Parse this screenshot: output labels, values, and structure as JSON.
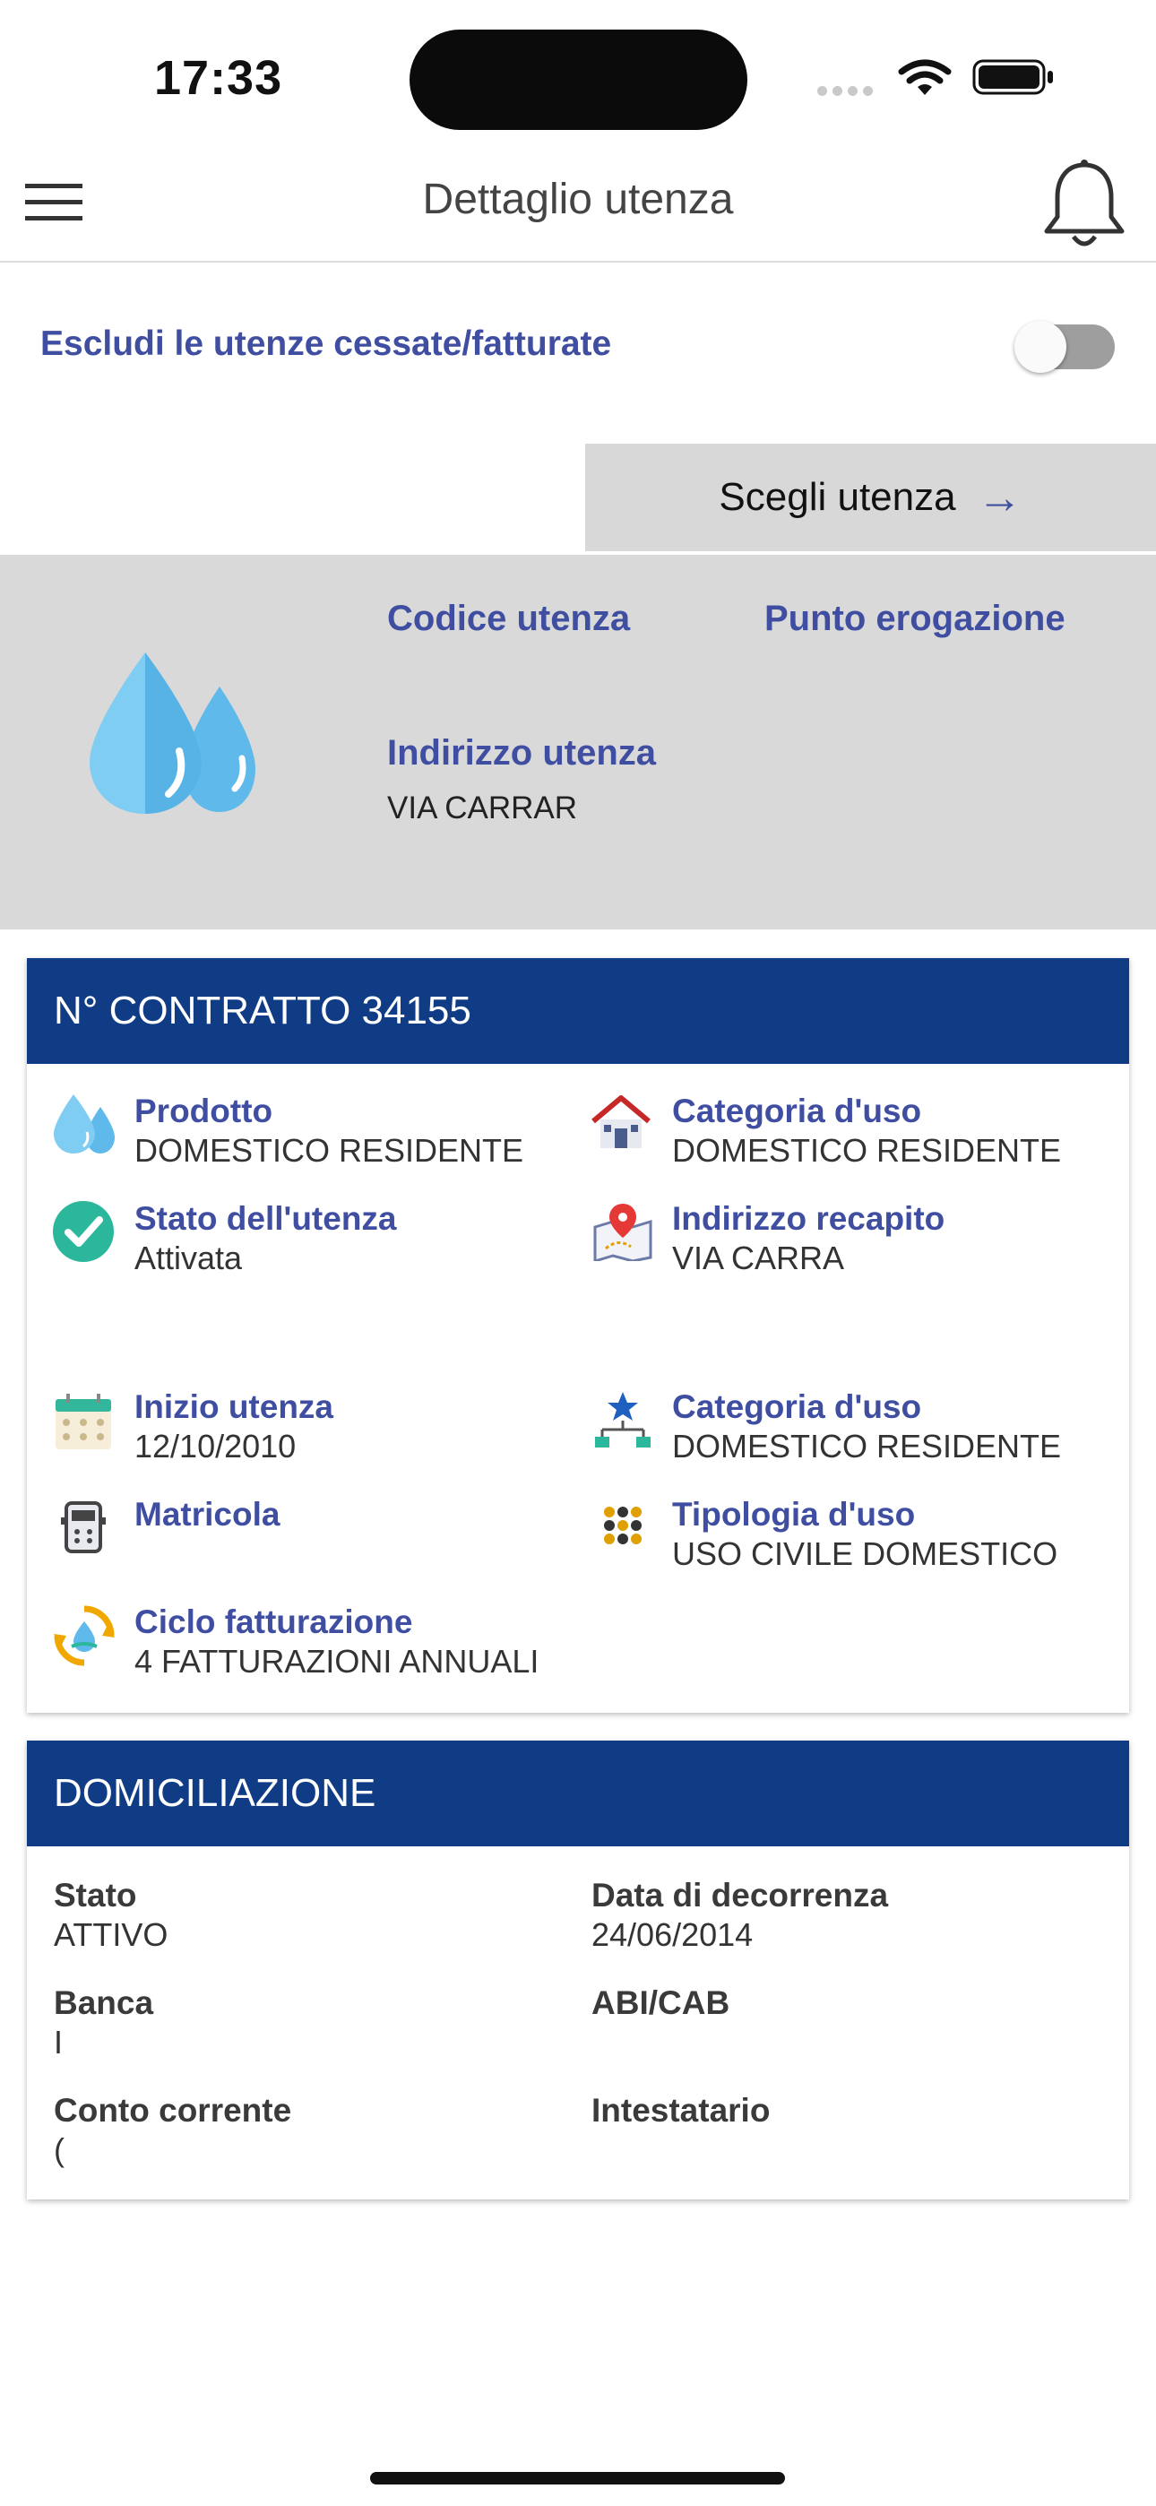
{
  "status_bar": {
    "time": "17:33"
  },
  "header": {
    "title": "Dettaglio utenza"
  },
  "filter": {
    "exclude_label": "Escludi le utenze cessate/fatturate",
    "exclude_enabled": false
  },
  "chooser": {
    "label": "Scegli utenza",
    "arrow": "→"
  },
  "summary": {
    "codice_label": "Codice utenza",
    "punto_label": "Punto erogazione",
    "indirizzo_label": "Indirizzo utenza",
    "indirizzo_value": "VIA CARRAR"
  },
  "contract": {
    "title": "N° CONTRATTO 34155",
    "items": [
      {
        "icon": "water-drops-icon",
        "label": "Prodotto",
        "value": "DOMESTICO RESIDENTE"
      },
      {
        "icon": "house-icon",
        "label": "Categoria d'uso",
        "value": "DOMESTICO RESIDENTE"
      },
      {
        "icon": "check-circle-icon",
        "label": "Stato dell'utenza",
        "value": "Attivata"
      },
      {
        "icon": "map-pin-icon",
        "label": "Indirizzo recapito",
        "value": "VIA CARRA"
      },
      {
        "icon": "calendar-icon",
        "label": "Inizio utenza",
        "value": "12/10/2010"
      },
      {
        "icon": "hierarchy-icon",
        "label": "Categoria d'uso",
        "value": "DOMESTICO RESIDENTE"
      },
      {
        "icon": "meter-icon",
        "label": "Matricola",
        "value": ""
      },
      {
        "icon": "dots-grid-icon",
        "label": "Tipologia d'uso",
        "value": "USO CIVILE DOMESTICO"
      },
      {
        "icon": "billing-cycle-icon",
        "label": "Ciclo fatturazione",
        "value": "4 FATTURAZIONI ANNUALI"
      }
    ]
  },
  "domiciliazione": {
    "title": "DOMICILIAZIONE",
    "stato_label": "Stato",
    "stato_value": "ATTIVO",
    "data_label": "Data di decorrenza",
    "data_value": "24/06/2014",
    "banca_label": "Banca",
    "banca_value": "I",
    "abi_label": "ABI/CAB",
    "abi_value": "",
    "conto_label": "Conto corrente",
    "conto_value": "(",
    "intestatario_label": "Intestatario",
    "intestatario_value": ""
  },
  "colors": {
    "primary": "#103c86",
    "accent": "#3f4ea0",
    "band": "#d9d9d9"
  }
}
